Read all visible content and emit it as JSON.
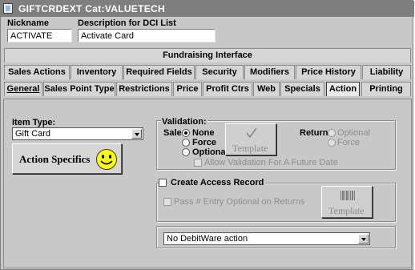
{
  "window": {
    "title": "GIFTCRDEXT  Cat:VALUETECH"
  },
  "header": {
    "nickname_label": "Nickname",
    "nickname_value": "ACTIVATE",
    "description_label": "Description for DCI List",
    "description_value": "Activate Card"
  },
  "tabs": {
    "row1": [
      {
        "label": "Fundraising Interface"
      }
    ],
    "row2": [
      {
        "label": "Sales Actions"
      },
      {
        "label": "Inventory"
      },
      {
        "label": "Required Fields"
      },
      {
        "label": "Security"
      },
      {
        "label": "Modifiers"
      },
      {
        "label": "Price History"
      },
      {
        "label": "Liability"
      }
    ],
    "row3": [
      {
        "label": "General"
      },
      {
        "label": "Sales Point Type"
      },
      {
        "label": "Restrictions"
      },
      {
        "label": "Price"
      },
      {
        "label": "Profit Ctrs"
      },
      {
        "label": "Web"
      },
      {
        "label": "Specials"
      },
      {
        "label": "Action"
      },
      {
        "label": "Printing"
      }
    ],
    "active": "Action"
  },
  "action": {
    "item_type_label": "Item Type:",
    "item_type_value": "Gift Card",
    "action_specifics_label": "Action Specifics",
    "validation": {
      "label": "Validation:",
      "sale_label": "Sale:",
      "sale_options": [
        "None",
        "Force",
        "Optional"
      ],
      "sale_selected": "None",
      "template_label": "Template",
      "allow_future_label": "Allow Validation For A Future Date",
      "return_label": "Return:",
      "return_options": [
        "Optional",
        "Force"
      ]
    },
    "access": {
      "create_label": "Create Access Record",
      "pass_entry_label": "Pass # Entry Optional on Returns",
      "template_label": "Template"
    },
    "debitware_value": "No DebitWare action"
  },
  "colors": {
    "title_bar": "#7f7f7f",
    "smiley": "#ffff00"
  }
}
